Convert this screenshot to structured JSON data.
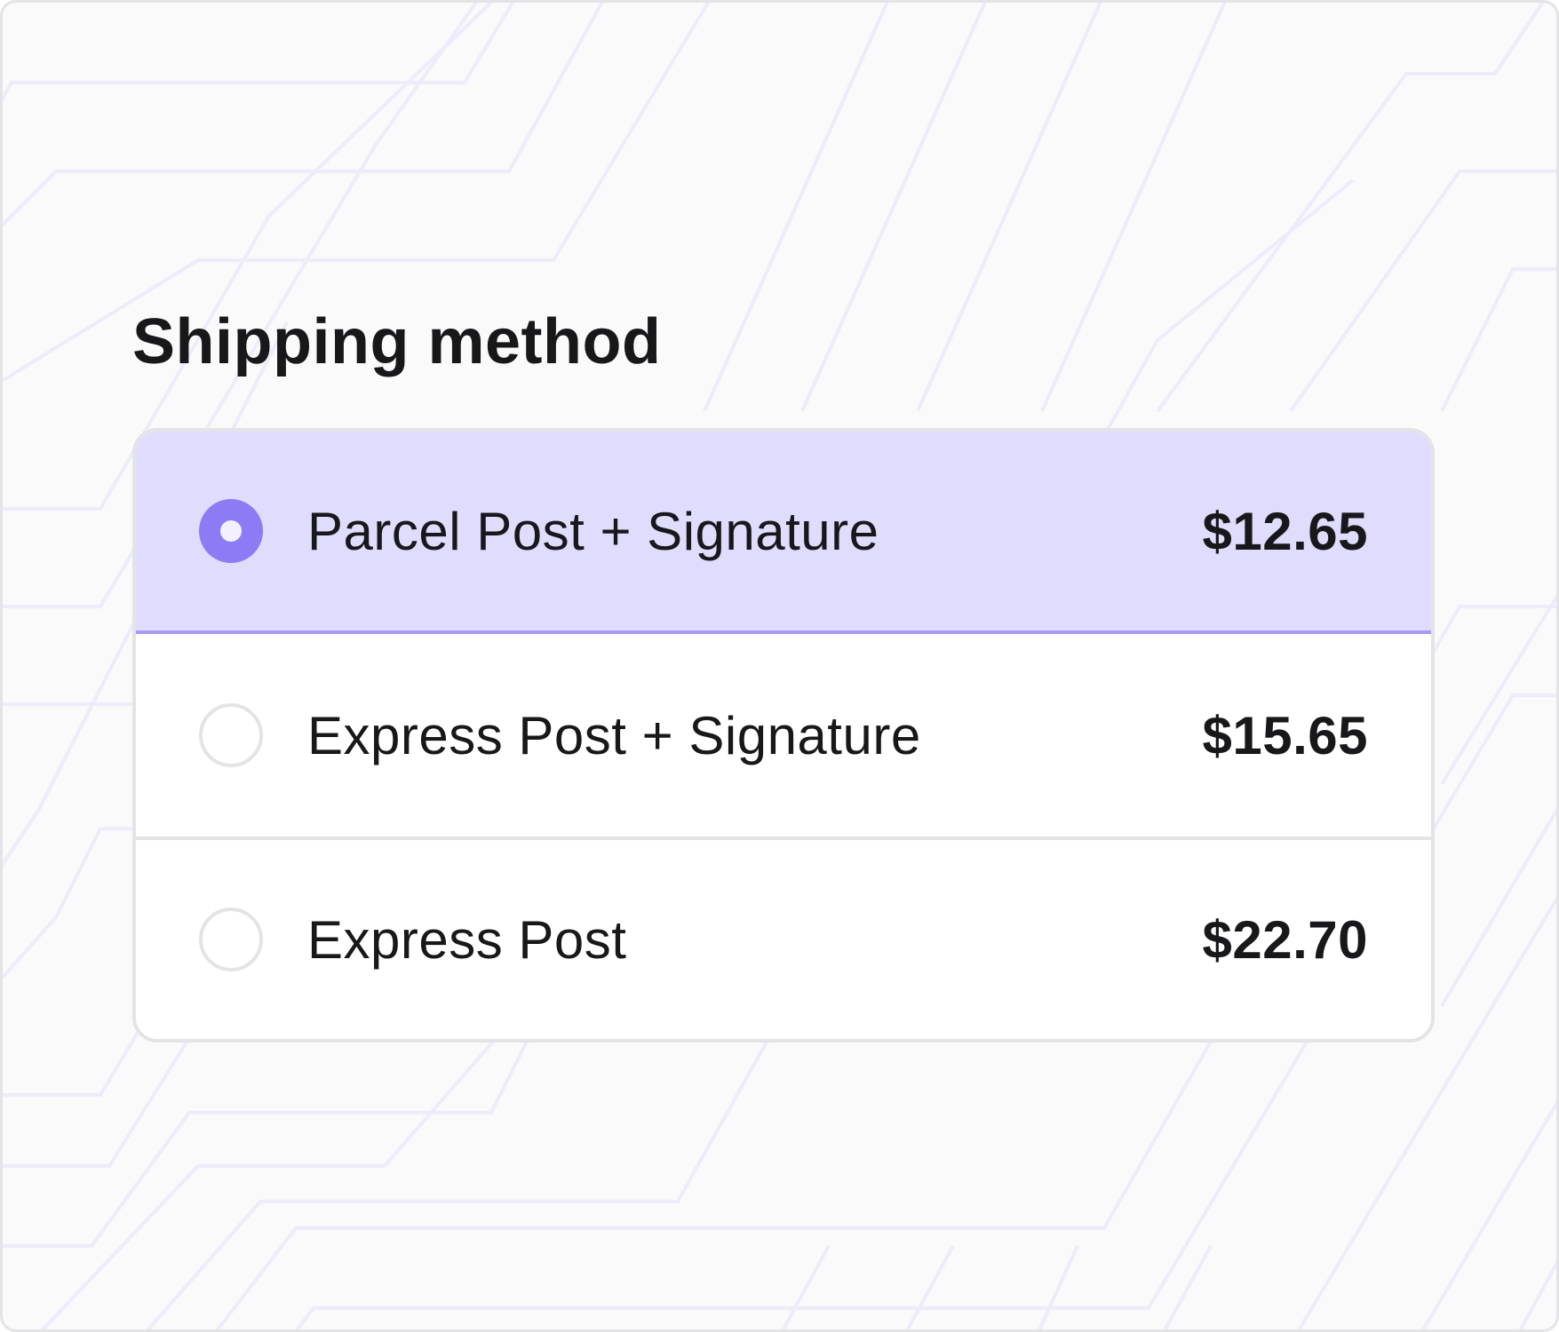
{
  "shipping": {
    "title": "Shipping method",
    "options": [
      {
        "label": "Parcel Post + Signature",
        "price": "$12.65",
        "selected": true
      },
      {
        "label": "Express Post + Signature",
        "price": "$15.65",
        "selected": false
      },
      {
        "label": "Express Post",
        "price": "$22.70",
        "selected": false
      }
    ]
  },
  "colors": {
    "accent": "#8b7cf6",
    "selected_background": "#e0dcfd",
    "selected_border": "#a59bf5",
    "border": "#e4e4e7",
    "page_background": "#fafafa",
    "text": "#18181b"
  },
  "icons": {
    "radio_checked": "radio-checked-icon",
    "radio_unchecked": "radio-unchecked-icon"
  }
}
